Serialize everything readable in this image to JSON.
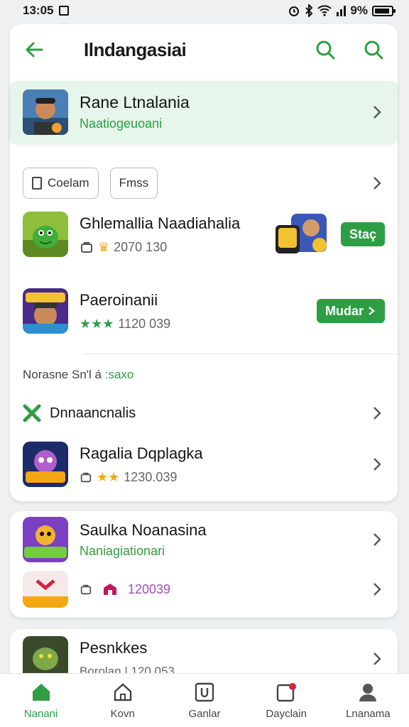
{
  "status_bar": {
    "time": "13:05",
    "battery": "9%"
  },
  "header": {
    "title": "Ilndangasiai"
  },
  "featured": {
    "title": "Rane Ltnalania",
    "subtitle": "Naatiogeuoani"
  },
  "chips": [
    {
      "label": "Coelam"
    },
    {
      "label": "Fmss"
    }
  ],
  "apps": [
    {
      "title": "Ghlemallia Naadiahalia",
      "meta": "2070 130",
      "button": "Staç"
    },
    {
      "title": "Paeroinanii",
      "meta": "1120 039",
      "button": "Mudar"
    }
  ],
  "section": {
    "label": "Norasne Sn'l á",
    "label_green": ":saxo"
  },
  "list": [
    {
      "title": "Dnnaancnalis"
    },
    {
      "title": "Ragalia Dqplagka",
      "meta": "1230.039"
    }
  ],
  "card2": [
    {
      "title": "Saulka Noanasina",
      "subtitle": "Naniagiationari"
    },
    {
      "meta": "120039"
    }
  ],
  "card3": {
    "title": "Pesnkkes",
    "subtitle": "Borolan | 120 053"
  },
  "nav": [
    {
      "label": "Nanani"
    },
    {
      "label": "Kovn"
    },
    {
      "label": "Ganlar"
    },
    {
      "label": "Dayclain"
    },
    {
      "label": "Lnanama"
    }
  ],
  "colors": {
    "accent": "#2e9e44",
    "featured_bg": "#e6f6ea"
  }
}
